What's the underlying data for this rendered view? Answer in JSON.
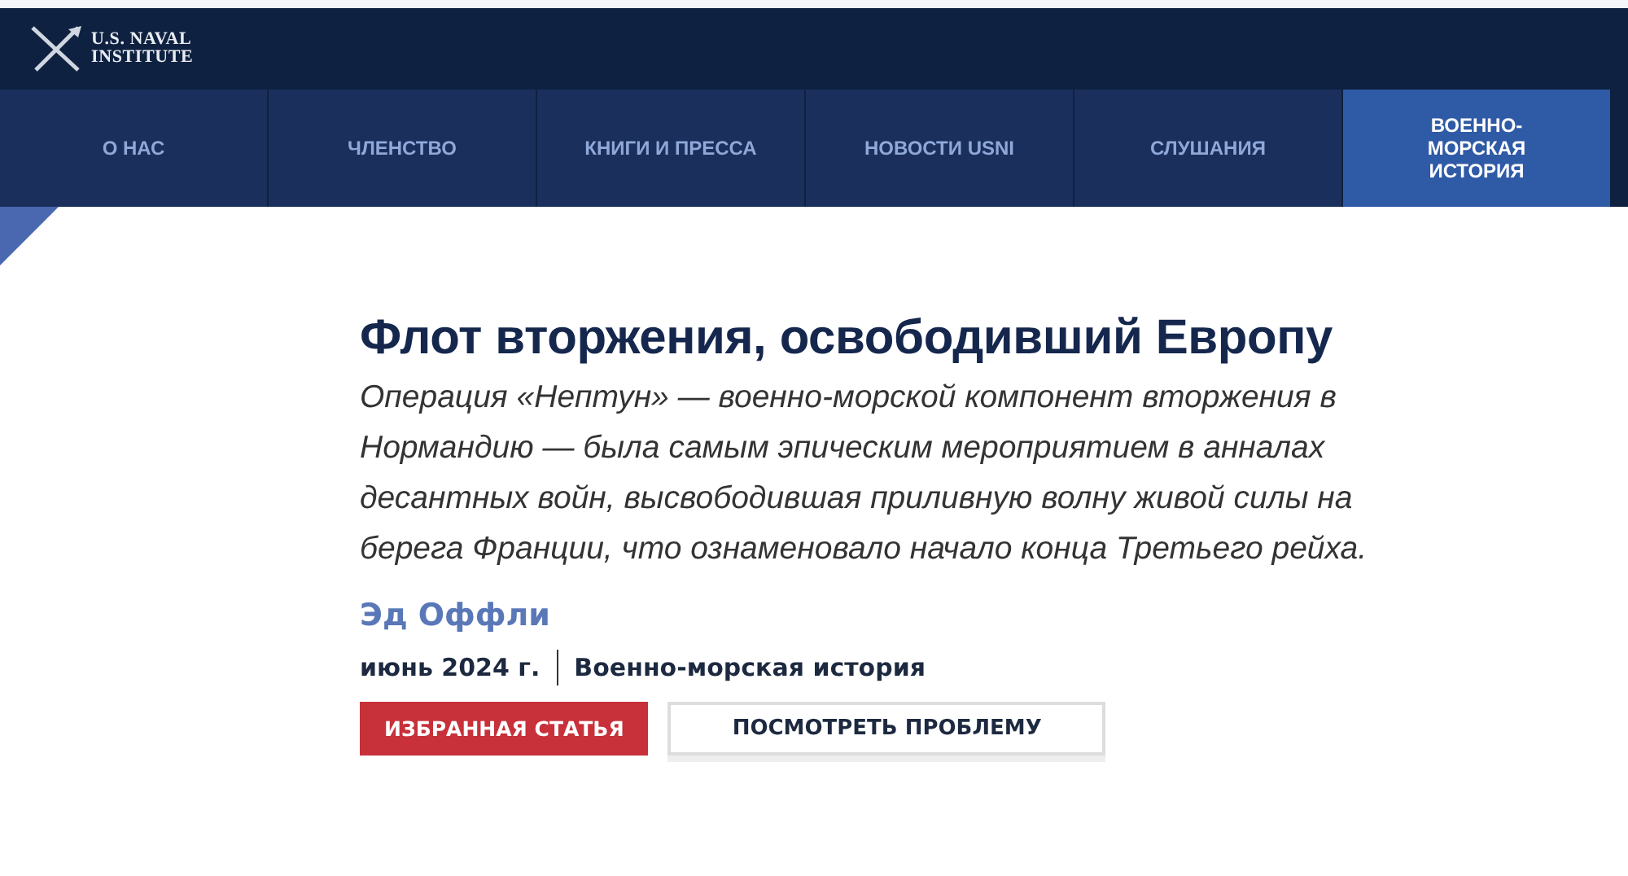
{
  "logo": {
    "line_1": "U.S. NAVAL",
    "line_2": "INSTITUTE"
  },
  "nav": [
    {
      "label": "О НАС",
      "selected": false
    },
    {
      "label": "ЧЛЕНСТВО",
      "selected": false
    },
    {
      "label": "КНИГИ И ПРЕССА",
      "selected": false
    },
    {
      "label": "НОВОСТИ USNI",
      "selected": false
    },
    {
      "label": "СЛУШАНИЯ",
      "selected": false
    },
    {
      "label": "ВОЕННО-МОРСКАЯ ИСТОРИЯ",
      "selected": true
    }
  ],
  "article": {
    "title": "Флот вторжения, освободивший Европу",
    "summary": "Операция «Нептун» — военно-морской компонент вторжения в Нормандию — была самым эпическим мероприятием в анналах десантных войн, высвободившая приливную волну живой силы на берега Франции, что ознаменовало начало конца Третьего рейха.",
    "author": "Эд Оффли",
    "date": "июнь 2024 г.",
    "category": "Военно-морская история",
    "buttons": [
      {
        "label": "ИЗБРАННАЯ СТАТЬЯ",
        "kind": "primary"
      },
      {
        "label": "ПОСМОТРЕТЬ ПРОБЛЕМУ",
        "kind": "outline"
      }
    ]
  }
}
